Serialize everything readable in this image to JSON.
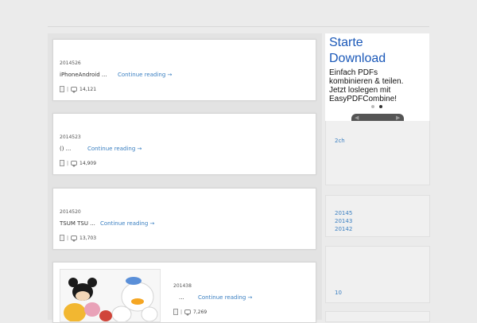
{
  "posts": [
    {
      "date": "2014526",
      "title": "iPhoneAndroid ...",
      "more": "Continue reading →",
      "views": "14,121"
    },
    {
      "date": "2014523",
      "title": "() ...",
      "more": "Continue reading →",
      "views": "14,909"
    },
    {
      "date": "2014520",
      "title": "TSUM TSU ...",
      "more": "Continue reading →",
      "views": "13,703"
    },
    {
      "date": "201438",
      "title": "...",
      "more": "Continue reading →",
      "views": "7,269"
    }
  ],
  "ad": {
    "title": "Starte\nDownload",
    "body": "Einfach PDFs\nkombinieren & teilen.\nJetzt loslegen mit\nEasyPDFCombine!"
  },
  "sidebar": {
    "link_2ch": "2ch",
    "archives": [
      "20145",
      "20143",
      "20142"
    ],
    "count_link": "10"
  },
  "colors": {
    "accent": "#3a7fc1",
    "ad_title": "#1a58b8",
    "background": "#ebebeb"
  }
}
